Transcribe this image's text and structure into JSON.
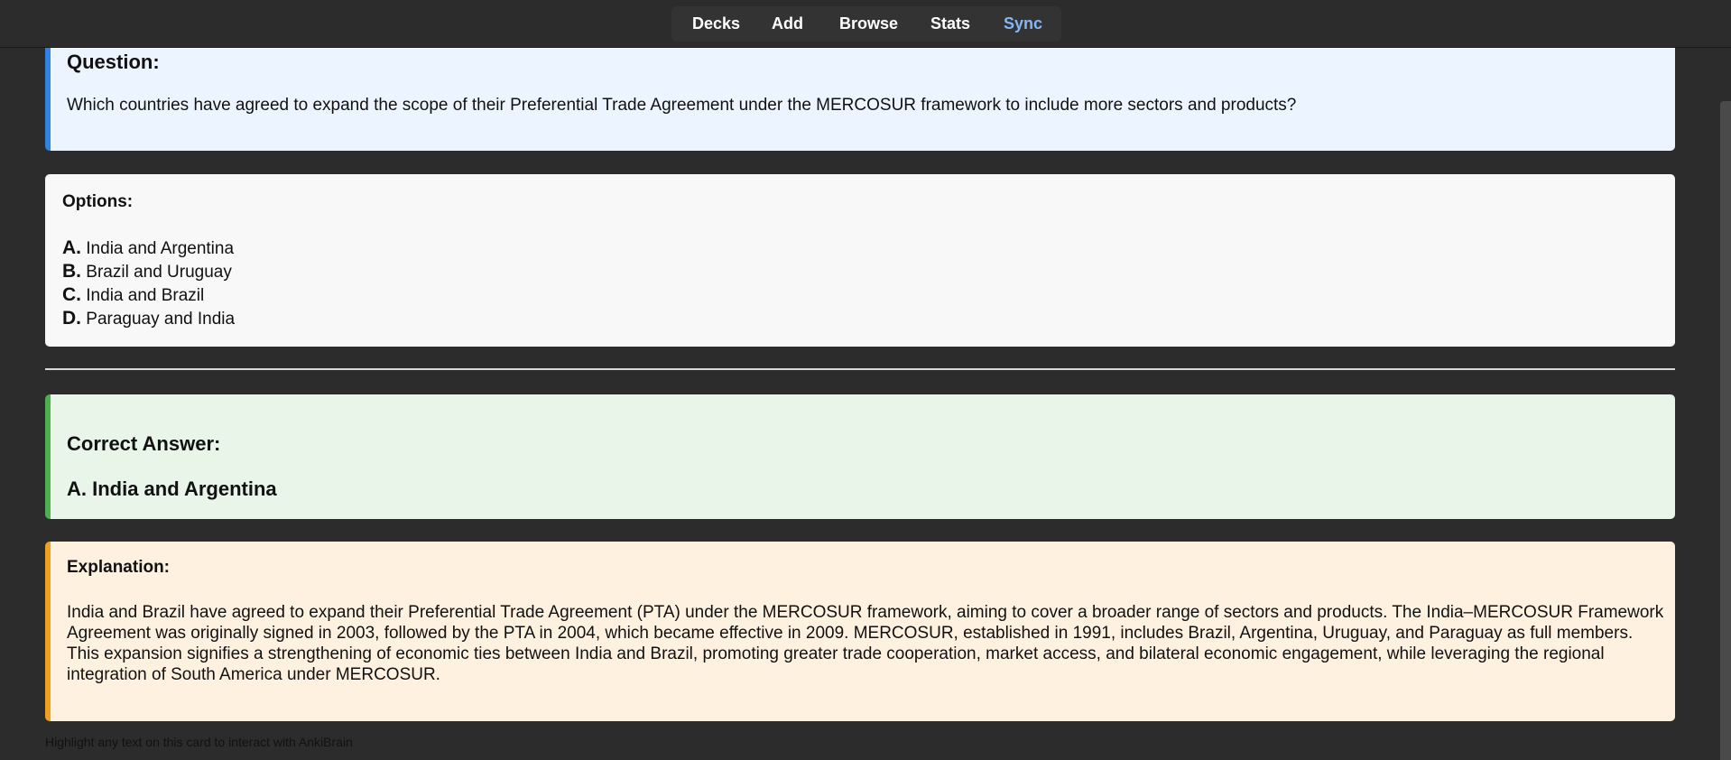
{
  "nav": {
    "decks": "Decks",
    "add": "Add",
    "browse": "Browse",
    "stats": "Stats",
    "sync": "Sync"
  },
  "question": {
    "title": "Question:",
    "text": "Which countries have agreed to expand the scope of their Preferential Trade Agreement under the MERCOSUR framework to include more sectors and products?"
  },
  "options": {
    "title": "Options:",
    "items": [
      {
        "letter": "A.",
        "text": "India and Argentina"
      },
      {
        "letter": "B.",
        "text": "Brazil and Uruguay"
      },
      {
        "letter": "C.",
        "text": "India and Brazil"
      },
      {
        "letter": "D.",
        "text": "Paraguay and India"
      }
    ]
  },
  "answer": {
    "title": "Correct Answer:",
    "text": "A. India and Argentina"
  },
  "explanation": {
    "title": "Explanation:",
    "text": "India and Brazil have agreed to expand their Preferential Trade Agreement (PTA) under the MERCOSUR framework, aiming to cover a broader range of sectors and products. The India–MERCOSUR Framework Agreement was originally signed in 2003, followed by the PTA in 2004, which became effective in 2009. MERCOSUR, established in 1991, includes Brazil, Argentina, Uruguay, and Paraguay as full members. This expansion signifies a strengthening of economic ties between India and Brazil, promoting greater trade cooperation, market access, and bilateral economic engagement, while leveraging the regional integration of South America under MERCOSUR."
  },
  "footer": {
    "note": "Highlight any text on this card to interact with AnkiBrain"
  },
  "colors": {
    "background": "#2c2c2c",
    "sync_accent": "#85b6f5",
    "question_border": "#2f83e4",
    "answer_border": "#4caf50",
    "explanation_border": "#f0a020"
  }
}
